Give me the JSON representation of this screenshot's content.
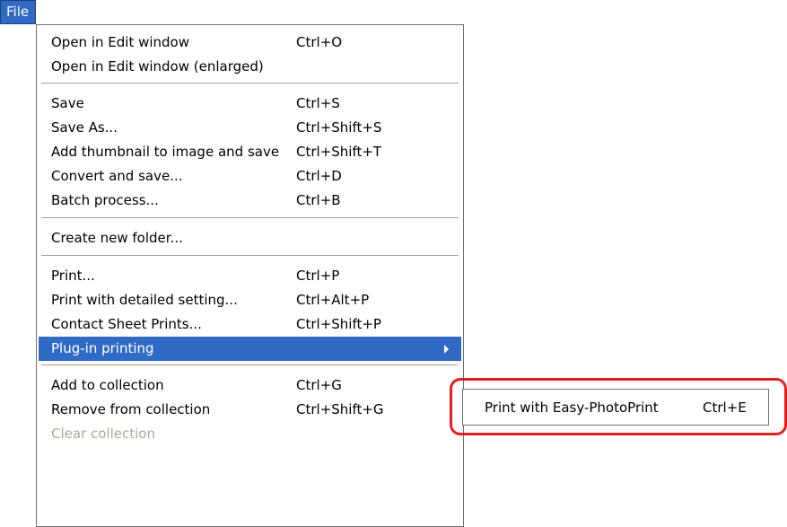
{
  "menubar": {
    "file_label": "File"
  },
  "menu": {
    "groups": [
      [
        {
          "label": "Open in Edit window",
          "shortcut": "Ctrl+O"
        },
        {
          "label": "Open in Edit window (enlarged)",
          "shortcut": ""
        }
      ],
      [
        {
          "label": "Save",
          "shortcut": "Ctrl+S"
        },
        {
          "label": "Save As...",
          "shortcut": "Ctrl+Shift+S"
        },
        {
          "label": "Add thumbnail to image and save",
          "shortcut": "Ctrl+Shift+T"
        },
        {
          "label": "Convert and save...",
          "shortcut": "Ctrl+D"
        },
        {
          "label": "Batch process...",
          "shortcut": "Ctrl+B"
        }
      ],
      [
        {
          "label": "Create new folder...",
          "shortcut": ""
        }
      ],
      [
        {
          "label": "Print...",
          "shortcut": "Ctrl+P"
        },
        {
          "label": "Print with detailed setting...",
          "shortcut": "Ctrl+Alt+P"
        },
        {
          "label": "Contact Sheet Prints...",
          "shortcut": "Ctrl+Shift+P"
        },
        {
          "label": "Plug-in printing",
          "shortcut": "",
          "state": "highlighted",
          "has_submenu": true
        }
      ],
      [
        {
          "label": "Add to collection",
          "shortcut": "Ctrl+G"
        },
        {
          "label": "Remove from collection",
          "shortcut": "Ctrl+Shift+G"
        },
        {
          "label": "Clear collection",
          "shortcut": "",
          "state": "disabled"
        }
      ]
    ]
  },
  "submenu": {
    "item": {
      "label": "Print with Easy-PhotoPrint",
      "shortcut": "Ctrl+E"
    }
  },
  "colors": {
    "highlight": "#316ac5",
    "annotation_outline": "#e02020",
    "disabled_text": "#aca899"
  }
}
